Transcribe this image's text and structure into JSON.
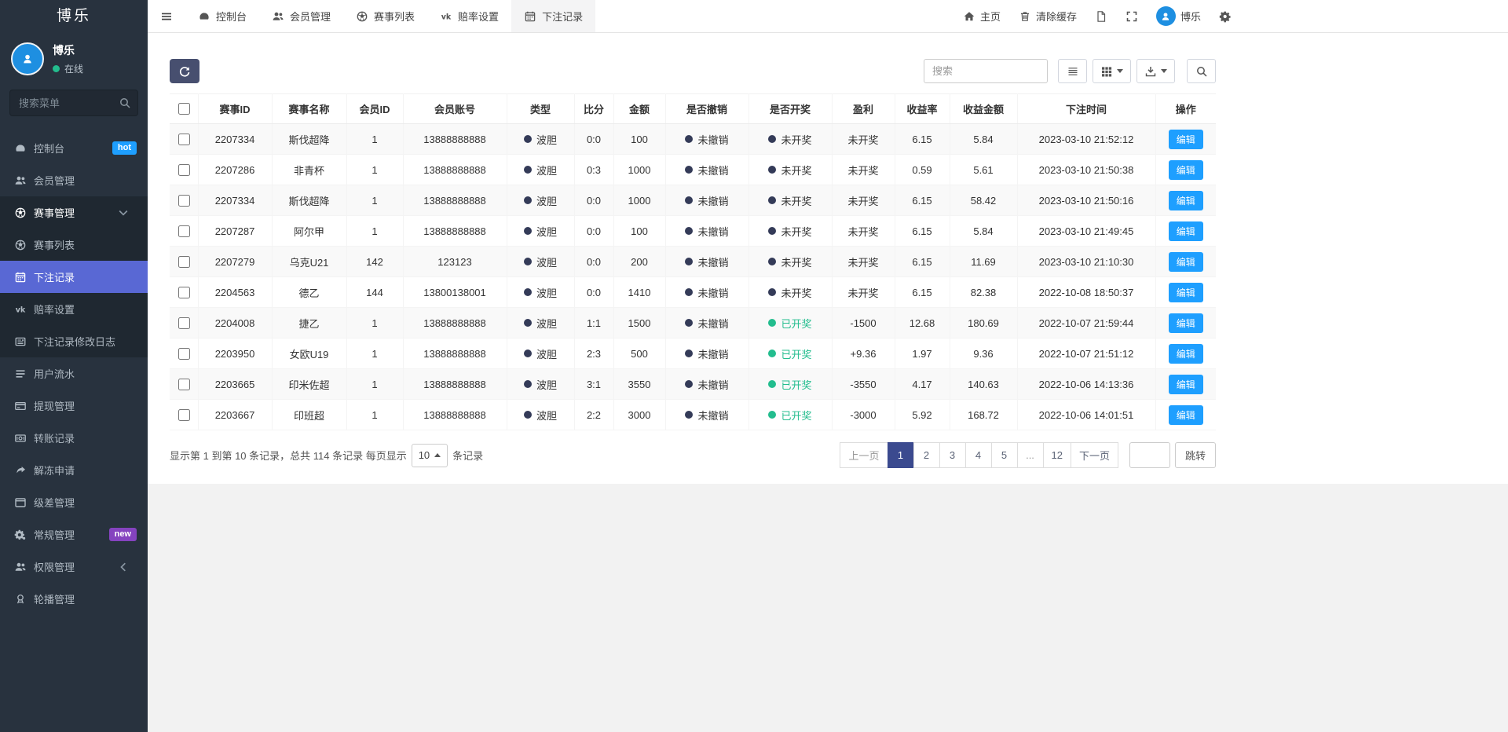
{
  "app": {
    "brand": "博乐"
  },
  "colors": {
    "accent": "#5968d4",
    "blue": "#1e9fff",
    "green": "#23bd8e",
    "dot_dark": "#343b58",
    "badge_new_purple": "#8543bf",
    "dark_btn": "#474f6f",
    "page_active": "#3b4a8f",
    "avatar_blue": "#1e8fe1"
  },
  "sidebar": {
    "user": {
      "name": "博乐",
      "status": "在线"
    },
    "search_placeholder": "搜索菜单",
    "items": [
      {
        "key": "console",
        "label": "控制台",
        "icon": "tachometer-icon",
        "badge": {
          "text": "hot",
          "color": "#1e9fff"
        }
      },
      {
        "key": "members",
        "label": "会员管理",
        "icon": "users-icon"
      },
      {
        "key": "match-manage",
        "label": "赛事管理",
        "icon": "soccer-icon",
        "open": true,
        "chevron": "down"
      },
      {
        "key": "match-list",
        "label": "赛事列表",
        "icon": "soccer-icon",
        "sub": true
      },
      {
        "key": "bet-records",
        "label": "下注记录",
        "icon": "calendar-icon",
        "sub": true,
        "active": true
      },
      {
        "key": "odds-settings",
        "label": "赔率设置",
        "icon": "vk-icon",
        "sub": true
      },
      {
        "key": "bet-edit-log",
        "label": "下注记录修改日志",
        "icon": "newspaper-icon",
        "sub": true
      },
      {
        "key": "user-flow",
        "label": "用户流水",
        "icon": "bars-icon"
      },
      {
        "key": "withdraw",
        "label": "提现管理",
        "icon": "withdraw-icon"
      },
      {
        "key": "transfer",
        "label": "转账记录",
        "icon": "transfer-icon"
      },
      {
        "key": "unfreeze",
        "label": "解冻申请",
        "icon": "share-icon"
      },
      {
        "key": "level",
        "label": "级差管理",
        "icon": "window-icon"
      },
      {
        "key": "general",
        "label": "常规管理",
        "icon": "cogs-icon",
        "badge": {
          "text": "new",
          "color": "#8543bf"
        }
      },
      {
        "key": "permission",
        "label": "权限管理",
        "icon": "users-icon",
        "chevron": "left"
      },
      {
        "key": "carousel",
        "label": "轮播管理",
        "icon": "award-icon"
      }
    ]
  },
  "topbar": {
    "tabs": [
      {
        "key": "console",
        "label": "控制台",
        "icon": "tachometer-icon"
      },
      {
        "key": "members",
        "label": "会员管理",
        "icon": "users-icon"
      },
      {
        "key": "match-list",
        "label": "赛事列表",
        "icon": "soccer-icon"
      },
      {
        "key": "odds-settings",
        "label": "赔率设置",
        "icon": "vk-icon"
      },
      {
        "key": "bet-records",
        "label": "下注记录",
        "icon": "calendar-icon",
        "active": true
      }
    ],
    "right": {
      "home": "主页",
      "clear_cache": "清除缓存",
      "username": "博乐"
    }
  },
  "toolbar": {
    "search_placeholder": "搜索",
    "buttons": [
      {
        "key": "toggle-list",
        "icon": "list-icon"
      },
      {
        "key": "columns",
        "icon": "grid-icon",
        "caret": true
      },
      {
        "key": "export",
        "icon": "export-icon",
        "caret": true
      },
      {
        "key": "search",
        "icon": "search-icon",
        "lone": true
      }
    ]
  },
  "table": {
    "columns": [
      "赛事ID",
      "赛事名称",
      "会员ID",
      "会员账号",
      "类型",
      "比分",
      "金额",
      "是否撤销",
      "是否开奖",
      "盈利",
      "收益率",
      "收益金额",
      "下注时间",
      "操作"
    ],
    "edit_label": "编辑",
    "rows": [
      {
        "match_id": "2207334",
        "match_name": "斯伐超降",
        "member_id": "1",
        "account": "13888888888",
        "type": "波胆",
        "score": "0:0",
        "amount": "100",
        "cancel": "未撤销",
        "draw": "未开奖",
        "profit": "未开奖",
        "rate": "6.15",
        "income": "5.84",
        "time": "2023-03-10 21:52:12"
      },
      {
        "match_id": "2207286",
        "match_name": "非青杯",
        "member_id": "1",
        "account": "13888888888",
        "type": "波胆",
        "score": "0:3",
        "amount": "1000",
        "cancel": "未撤销",
        "draw": "未开奖",
        "profit": "未开奖",
        "rate": "0.59",
        "income": "5.61",
        "time": "2023-03-10 21:50:38"
      },
      {
        "match_id": "2207334",
        "match_name": "斯伐超降",
        "member_id": "1",
        "account": "13888888888",
        "type": "波胆",
        "score": "0:0",
        "amount": "1000",
        "cancel": "未撤销",
        "draw": "未开奖",
        "profit": "未开奖",
        "rate": "6.15",
        "income": "58.42",
        "time": "2023-03-10 21:50:16"
      },
      {
        "match_id": "2207287",
        "match_name": "阿尔甲",
        "member_id": "1",
        "account": "13888888888",
        "type": "波胆",
        "score": "0:0",
        "amount": "100",
        "cancel": "未撤销",
        "draw": "未开奖",
        "profit": "未开奖",
        "rate": "6.15",
        "income": "5.84",
        "time": "2023-03-10 21:49:45"
      },
      {
        "match_id": "2207279",
        "match_name": "乌克U21",
        "member_id": "142",
        "account": "123123",
        "type": "波胆",
        "score": "0:0",
        "amount": "200",
        "cancel": "未撤销",
        "draw": "未开奖",
        "profit": "未开奖",
        "rate": "6.15",
        "income": "11.69",
        "time": "2023-03-10 21:10:30"
      },
      {
        "match_id": "2204563",
        "match_name": "德乙",
        "member_id": "144",
        "account": "13800138001",
        "type": "波胆",
        "score": "0:0",
        "amount": "1410",
        "cancel": "未撤销",
        "draw": "未开奖",
        "profit": "未开奖",
        "rate": "6.15",
        "income": "82.38",
        "time": "2022-10-08 18:50:37"
      },
      {
        "match_id": "2204008",
        "match_name": "捷乙",
        "member_id": "1",
        "account": "13888888888",
        "type": "波胆",
        "score": "1:1",
        "amount": "1500",
        "cancel": "未撤销",
        "draw": "已开奖",
        "profit": "-1500",
        "rate": "12.68",
        "income": "180.69",
        "time": "2022-10-07 21:59:44"
      },
      {
        "match_id": "2203950",
        "match_name": "女欧U19",
        "member_id": "1",
        "account": "13888888888",
        "type": "波胆",
        "score": "2:3",
        "amount": "500",
        "cancel": "未撤销",
        "draw": "已开奖",
        "profit": "+9.36",
        "rate": "1.97",
        "income": "9.36",
        "time": "2022-10-07 21:51:12"
      },
      {
        "match_id": "2203665",
        "match_name": "印米佐超",
        "member_id": "1",
        "account": "13888888888",
        "type": "波胆",
        "score": "3:1",
        "amount": "3550",
        "cancel": "未撤销",
        "draw": "已开奖",
        "profit": "-3550",
        "rate": "4.17",
        "income": "140.63",
        "time": "2022-10-06 14:13:36"
      },
      {
        "match_id": "2203667",
        "match_name": "印班超",
        "member_id": "1",
        "account": "13888888888",
        "type": "波胆",
        "score": "2:2",
        "amount": "3000",
        "cancel": "未撤销",
        "draw": "已开奖",
        "profit": "-3000",
        "rate": "5.92",
        "income": "168.72",
        "time": "2022-10-06 14:01:51"
      }
    ]
  },
  "pagination": {
    "summary_prefix": "显示第 1 到第 10 条记录，总共 114 条记录 每页显示",
    "page_size": "10",
    "summary_suffix": "条记录",
    "prev": "上一页",
    "next": "下一页",
    "pages": [
      "1",
      "2",
      "3",
      "4",
      "5",
      "...",
      "12"
    ],
    "active_page": "1",
    "jump_label": "跳转"
  }
}
